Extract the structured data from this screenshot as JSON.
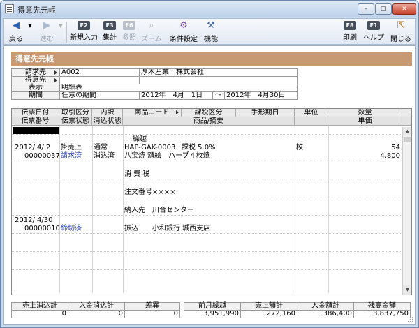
{
  "window": {
    "title": "得意先元帳",
    "min": "–",
    "max": "□",
    "close": "✕"
  },
  "toolbar": {
    "back": "戻る",
    "forward": "進む",
    "new": {
      "key": "F2",
      "label": "新規入力"
    },
    "summary": {
      "key": "F3",
      "label": "集計"
    },
    "ref": {
      "key": "F6",
      "label": "参照"
    },
    "zoom": {
      "label": "ズーム"
    },
    "cond": {
      "label": "条件設定"
    },
    "func": {
      "label": "機能"
    },
    "print": {
      "key": "F8",
      "label": "印刷"
    },
    "help": {
      "key": "F1",
      "label": "ヘルプ"
    },
    "close": {
      "label": "閉じる"
    }
  },
  "form": {
    "title": "得意先元帳"
  },
  "header": {
    "billing_label": "請求先",
    "billing_code": "A002",
    "billing_name": "厚木産業　株式会社",
    "customer_label": "得意先",
    "customer_value": "",
    "display_label": "表示",
    "display_value": "明細表",
    "period_label": "期間",
    "period_type": "任意の期間",
    "period_from": "2012年　4月　1日",
    "period_sep": "〜",
    "period_to": "2012年　4月30日"
  },
  "grid": {
    "headers_row1": [
      "伝票日付",
      "取引区分",
      "内訳",
      "商品コード",
      "課税区分",
      "手形期日",
      "単位",
      "数量"
    ],
    "headers_row2": [
      "伝票番号",
      "伝票状態",
      "消込状態",
      "商品/摘要",
      "単価"
    ],
    "rows": [
      {
        "desc": "繰越"
      },
      {
        "date": "2012/ 4/ 2",
        "type": "掛売上",
        "breakdown": "通常",
        "code": "HAP-GAK-0003",
        "tax": "課税 5.0%",
        "unit": "枚",
        "qty": "54",
        "slip_no": "00000037",
        "slip_state": "請求済",
        "clear_state": "消込済",
        "product": "八宝焼 額絵　ハーブ４枚焼",
        "price": "4,800"
      },
      {
        "desc": "消 費 税"
      },
      {
        "desc": "注文番号××××"
      },
      {
        "desc": "納入先　川合センター"
      },
      {
        "date": "2012/ 4/30",
        "slip_no": "00000010",
        "slip_state": "締切済",
        "desc": "振込　　小和銀行 城西支店"
      }
    ]
  },
  "totals_left": {
    "headers": [
      "売上消込計",
      "入金消込計",
      "差異"
    ],
    "values": [
      "0",
      "0",
      "0"
    ]
  },
  "totals_right": {
    "headers": [
      "前月繰越",
      "売上額計",
      "入金額計",
      "残高金額"
    ],
    "values": [
      "3,951,990",
      "272,160",
      "386,400",
      "3,837,750"
    ]
  }
}
